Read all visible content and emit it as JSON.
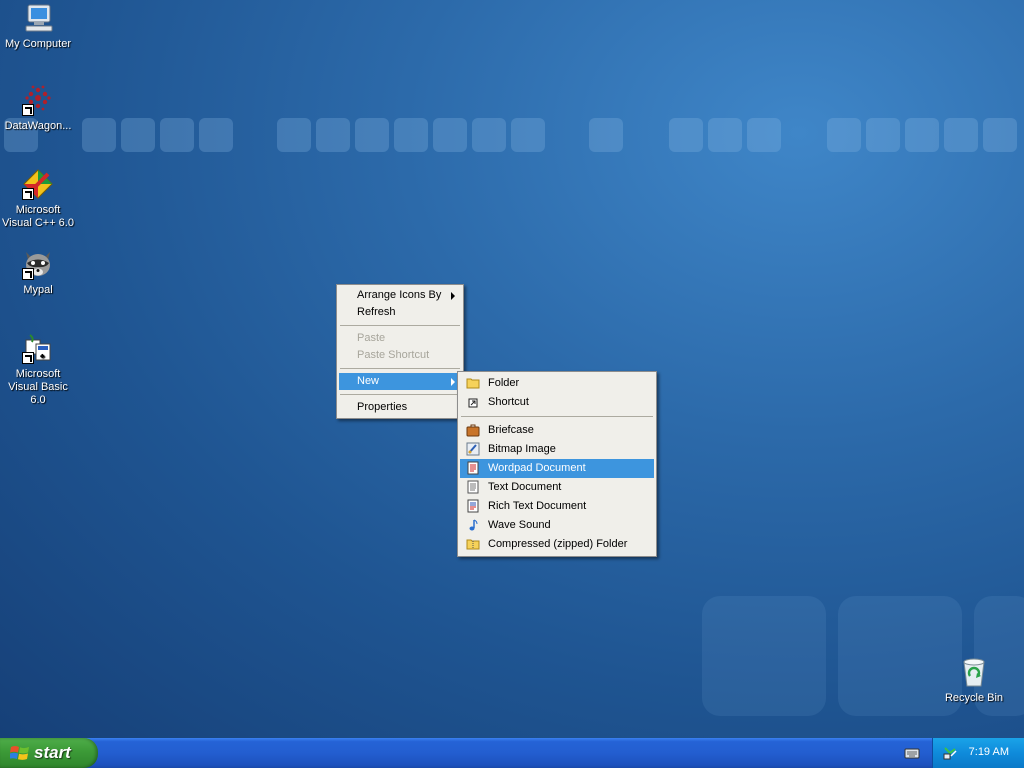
{
  "desktop": {
    "icons": [
      {
        "label": "My Computer",
        "icon": "my-computer-icon"
      },
      {
        "label": "DataWagon...",
        "icon": "datawagon-icon"
      },
      {
        "label": "Microsoft Visual C++ 6.0",
        "icon": "visual-cpp-icon"
      },
      {
        "label": "Mypal",
        "icon": "mypal-raccoon-icon"
      },
      {
        "label": "Microsoft Visual Basic 6.0",
        "icon": "visual-basic-icon"
      },
      {
        "label": "Recycle Bin",
        "icon": "recycle-bin-icon"
      }
    ]
  },
  "context_menu": {
    "items": [
      {
        "label": "Arrange Icons By",
        "submenu": true
      },
      {
        "label": "Refresh"
      },
      {
        "label": "Paste",
        "disabled": true
      },
      {
        "label": "Paste Shortcut",
        "disabled": true
      },
      {
        "label": "New",
        "submenu": true,
        "selected": true
      },
      {
        "label": "Properties"
      }
    ]
  },
  "new_submenu": {
    "items": [
      {
        "label": "Folder",
        "icon": "folder-icon"
      },
      {
        "label": "Shortcut",
        "icon": "shortcut-icon"
      },
      {
        "label": "Briefcase",
        "icon": "briefcase-icon"
      },
      {
        "label": "Bitmap Image",
        "icon": "bitmap-image-icon"
      },
      {
        "label": "Wordpad Document",
        "icon": "wordpad-document-icon",
        "selected": true
      },
      {
        "label": "Text Document",
        "icon": "text-document-icon"
      },
      {
        "label": "Rich Text Document",
        "icon": "rich-text-document-icon"
      },
      {
        "label": "Wave Sound",
        "icon": "wave-sound-icon"
      },
      {
        "label": "Compressed (zipped) Folder",
        "icon": "zipped-folder-icon"
      }
    ]
  },
  "taskbar": {
    "start_label": "start",
    "clock": "7:19 AM"
  },
  "colors": {
    "menu_highlight": "#3d95de",
    "taskbar_blue": "#245edb",
    "start_green": "#3c9a37"
  }
}
